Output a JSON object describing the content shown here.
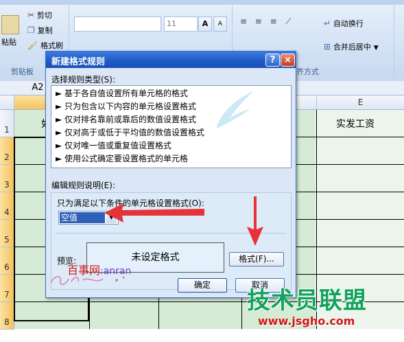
{
  "ribbon": {
    "clipboard": {
      "paste": "粘贴",
      "cut": "剪切",
      "copy": "复制",
      "format_painter": "格式刷",
      "group": "剪贴板"
    },
    "font": {
      "size": "11",
      "grow": "A",
      "shrink": "A"
    },
    "alignment": {
      "wrap_text": "自动换行",
      "merge_center": "合并后居中",
      "group": "齐方式"
    }
  },
  "namebox": {
    "value": "A2"
  },
  "sheet": {
    "col_e": "E",
    "rows": [
      "1",
      "2",
      "3",
      "4",
      "5",
      "6",
      "7",
      "8"
    ],
    "e1": "实发工资",
    "a1_partial": "如"
  },
  "dialog": {
    "title": "新建格式规则",
    "help": "?",
    "close": "×",
    "select_type_label": "选择规则类型(S):",
    "rules": [
      "基于各自值设置所有单元格的格式",
      "只为包含以下内容的单元格设置格式",
      "仅对排名靠前或靠后的数值设置格式",
      "仅对高于或低于平均值的数值设置格式",
      "仅对唯一值或重复值设置格式",
      "使用公式确定要设置格式的单元格"
    ],
    "edit_desc_label": "编辑规则说明(E):",
    "condition_label": "只为满足以下条件的单元格设置格式(O):",
    "condition_value": "空值",
    "preview_label": "预览:",
    "preview_text": "未设定格式",
    "format_button": "格式(F)...",
    "ok": "确定",
    "cancel": "取消"
  },
  "watermarks": {
    "site": "百事网",
    "site_suffix": ":anran",
    "logo": "技术员联盟",
    "url": "www.jsgho.com"
  },
  "colors": {
    "arrow": "#e8323a",
    "logo_green": "#11a25b",
    "url_red": "#d01818",
    "title_blue": "#1f5bc7"
  }
}
